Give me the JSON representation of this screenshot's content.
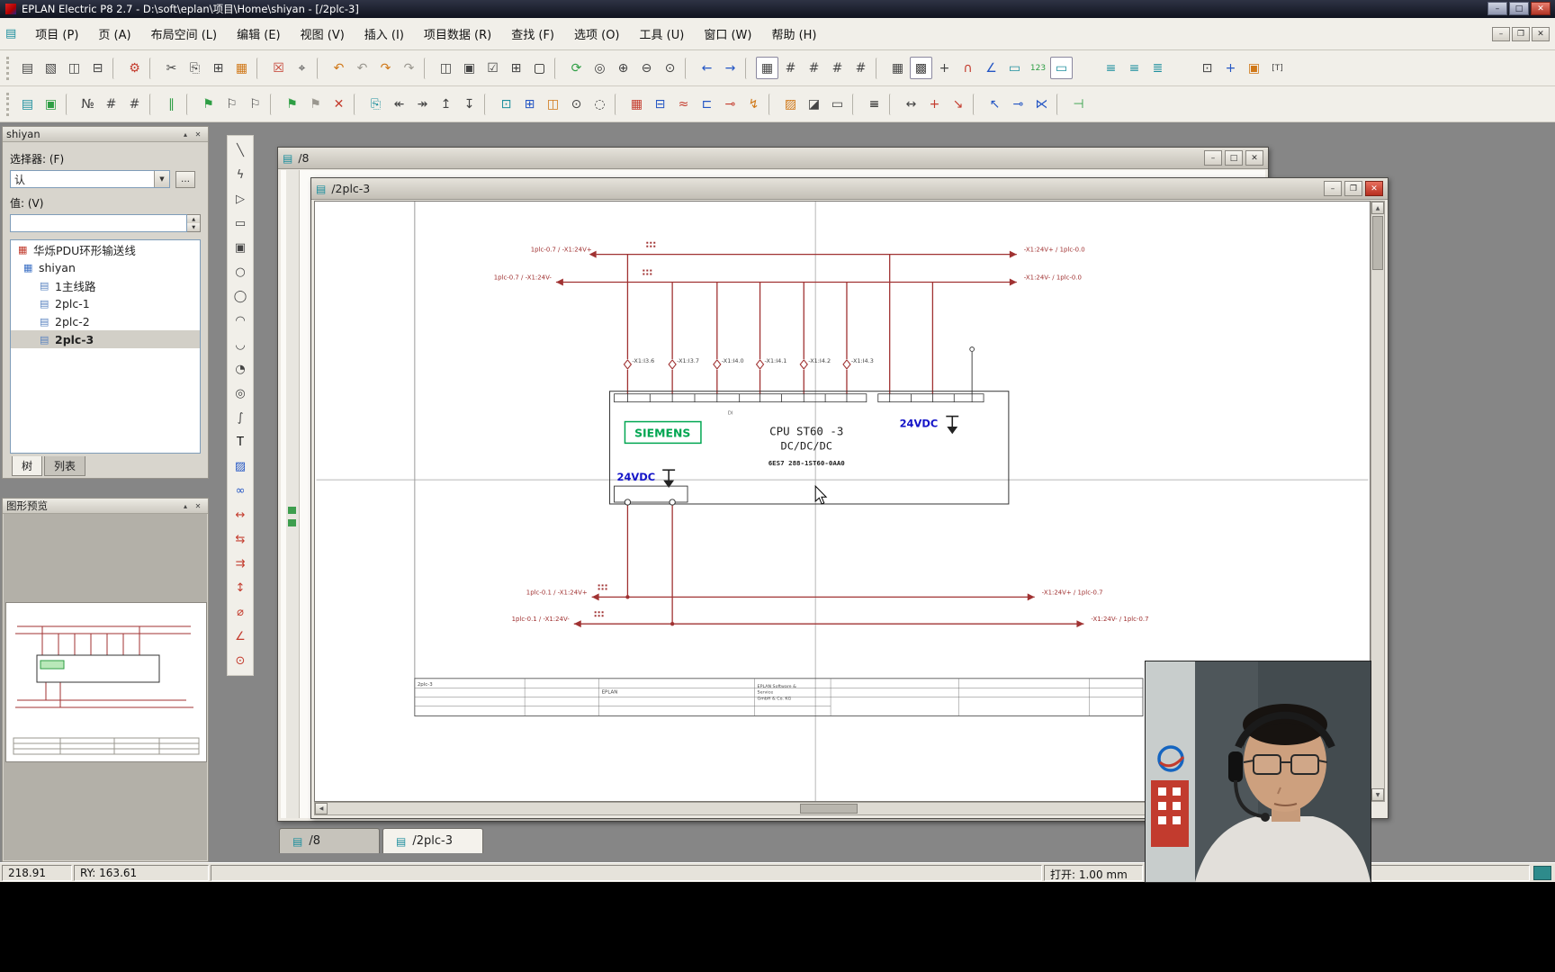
{
  "titlebar": {
    "title": "EPLAN Electric P8 2.7 - D:\\soft\\eplan\\项目\\Home\\shiyan - [/2plc-3]",
    "controls": {
      "min": "–",
      "max": "□",
      "close": "✕"
    }
  },
  "menu": {
    "items": [
      {
        "n": "menu-project",
        "label": "项目 (P)"
      },
      {
        "n": "menu-page",
        "label": "页 (A)"
      },
      {
        "n": "menu-layout-space",
        "label": "布局空间 (L)"
      },
      {
        "n": "menu-edit",
        "label": "编辑 (E)"
      },
      {
        "n": "menu-view",
        "label": "视图 (V)"
      },
      {
        "n": "menu-insert",
        "label": "插入 (I)"
      },
      {
        "n": "menu-project-data",
        "label": "项目数据 (R)"
      },
      {
        "n": "menu-find",
        "label": "查找 (F)"
      },
      {
        "n": "menu-options",
        "label": "选项 (O)"
      },
      {
        "n": "menu-tools",
        "label": "工具 (U)"
      },
      {
        "n": "menu-window",
        "label": "窗口 (W)"
      },
      {
        "n": "menu-help",
        "label": "帮助 (H)"
      }
    ],
    "child_controls": {
      "min": "–",
      "restore": "❐",
      "close": "✕"
    }
  },
  "glyphs": {
    "page_icon": "▤",
    "scroll_left": "◀",
    "scroll_right": "▶",
    "scroll_up": "▲",
    "scroll_down": "▼",
    "dots": "…",
    "combo_arrow": "▼",
    "spin_up": "▲",
    "spin_down": "▼",
    "collapse": "▴",
    "close": "✕"
  },
  "toolbar_main": {
    "items": [
      {
        "n": "new-icon",
        "g": "▤",
        "it": "true"
      },
      {
        "n": "open-icon",
        "g": "▧",
        "it": "true"
      },
      {
        "n": "print-preview-icon",
        "g": "◫",
        "it": "true"
      },
      {
        "n": "print-icon",
        "g": "⊟",
        "it": "true"
      },
      {
        "n": "separator",
        "g": "",
        "it": "false"
      },
      {
        "n": "settings-wrench-icon",
        "g": "⚙",
        "c": "red",
        "it": "true"
      },
      {
        "n": "separator",
        "g": "",
        "it": "false"
      },
      {
        "n": "cut-icon",
        "g": "✂",
        "it": "true"
      },
      {
        "n": "copy-icon",
        "g": "⎘",
        "it": "true"
      },
      {
        "n": "paste-icon",
        "g": "⊞",
        "it": "true"
      },
      {
        "n": "format-brush-icon",
        "g": "▦",
        "c": "orange",
        "it": "true"
      },
      {
        "n": "separator",
        "g": "",
        "it": "false"
      },
      {
        "n": "delete-icon",
        "g": "☒",
        "c": "red",
        "it": "true"
      },
      {
        "n": "select-icon",
        "g": "⌖",
        "it": "true"
      },
      {
        "n": "separator",
        "g": "",
        "it": "false"
      },
      {
        "n": "undo-icon",
        "g": "↶",
        "c": "orange",
        "it": "true"
      },
      {
        "n": "undo-list-icon",
        "g": "↶",
        "c": "gray",
        "it": "true"
      },
      {
        "n": "redo-icon",
        "g": "↷",
        "c": "orange",
        "it": "true"
      },
      {
        "n": "redo-list-icon",
        "g": "↷",
        "c": "gray",
        "it": "true"
      },
      {
        "n": "separator",
        "g": "",
        "it": "false"
      },
      {
        "n": "window-split-icon",
        "g": "◫",
        "it": "true"
      },
      {
        "n": "window-cascade-icon",
        "g": "▣",
        "it": "true"
      },
      {
        "n": "window-check-icon",
        "g": "☑",
        "it": "true"
      },
      {
        "n": "window-grid-icon",
        "g": "⊞",
        "it": "true"
      },
      {
        "n": "workspace-icon",
        "g": "▢",
        "c": "dark",
        "it": "true"
      },
      {
        "n": "separator",
        "g": "",
        "it": "false"
      },
      {
        "n": "refresh-icon",
        "g": "⟳",
        "c": "green",
        "it": "true"
      },
      {
        "n": "zoom-window-icon",
        "g": "◎",
        "it": "true"
      },
      {
        "n": "zoom-in-icon",
        "g": "⊕",
        "it": "true"
      },
      {
        "n": "zoom-out-icon",
        "g": "⊖",
        "it": "true"
      },
      {
        "n": "zoom-100-icon",
        "g": "⊙",
        "it": "true"
      },
      {
        "n": "separator",
        "g": "",
        "it": "false"
      },
      {
        "n": "back-icon",
        "g": "←",
        "c": "blue",
        "it": "true"
      },
      {
        "n": "forward-icon",
        "g": "→",
        "c": "blue",
        "it": "true"
      },
      {
        "n": "separator",
        "g": "",
        "it": "false"
      },
      {
        "n": "grid-a-icon",
        "g": "▦",
        "st": "on",
        "it": "true"
      },
      {
        "n": "grid-b-icon",
        "g": "#",
        "it": "true"
      },
      {
        "n": "grid-c-icon",
        "g": "#",
        "it": "true"
      },
      {
        "n": "grid-d-icon",
        "g": "#",
        "it": "true"
      },
      {
        "n": "grid-e-icon",
        "g": "#",
        "it": "true"
      },
      {
        "n": "separator",
        "g": "",
        "it": "false"
      },
      {
        "n": "grid-display-icon",
        "g": "▦",
        "it": "true"
      },
      {
        "n": "snap-grid-icon",
        "g": "▩",
        "st": "on",
        "it": "true"
      },
      {
        "n": "grid-size-icon",
        "g": "+",
        "it": "true"
      },
      {
        "n": "magnet-icon",
        "g": "∩",
        "c": "red",
        "it": "true"
      },
      {
        "n": "angle-snap-icon",
        "g": "∠",
        "c": "blue",
        "it": "true"
      },
      {
        "n": "ruler-icon",
        "g": "▭",
        "c": "teal",
        "it": "true"
      },
      {
        "n": "value-123-icon",
        "g": "123",
        "c": "green",
        "it": "true"
      },
      {
        "n": "panel-toggle-icon",
        "g": "▭",
        "st": "on",
        "c": "teal",
        "it": "true"
      },
      {
        "n": "spacer",
        "g": "",
        "it": "false"
      },
      {
        "n": "list-view-1-icon",
        "g": "≡",
        "c": "teal",
        "it": "true"
      },
      {
        "n": "list-view-2-icon",
        "g": "≡",
        "c": "teal",
        "it": "true"
      },
      {
        "n": "list-view-3-icon",
        "g": "≣",
        "c": "teal",
        "it": "true"
      },
      {
        "n": "spacer",
        "g": "",
        "it": "false"
      },
      {
        "n": "new-window-icon",
        "g": "⊡",
        "it": "true"
      },
      {
        "n": "position-icon",
        "g": "+",
        "c": "blue",
        "it": "true"
      },
      {
        "n": "cart-icon",
        "g": "▣",
        "c": "orange",
        "it": "true"
      },
      {
        "n": "text-mode-icon",
        "g": "[T]",
        "it": "true"
      }
    ]
  },
  "toolbar_second": {
    "items": [
      {
        "n": "page-nav-icon",
        "g": "▤",
        "c": "teal",
        "it": "true"
      },
      {
        "n": "plugin-icon",
        "g": "▣",
        "c": "green",
        "it": "true"
      },
      {
        "n": "separator",
        "g": "",
        "it": "false"
      },
      {
        "n": "numbering-icon",
        "g": "№",
        "it": "true"
      },
      {
        "n": "numbering-2-icon",
        "g": "#",
        "it": "true"
      },
      {
        "n": "numbering-3-icon",
        "g": "#",
        "it": "true"
      },
      {
        "n": "separator",
        "g": "",
        "it": "false"
      },
      {
        "n": "align-icon",
        "g": "∥",
        "c": "green",
        "it": "true"
      },
      {
        "n": "separator",
        "g": "",
        "it": "false"
      },
      {
        "n": "check-flag-icon",
        "g": "⚑",
        "c": "green",
        "it": "true"
      },
      {
        "n": "flag-2-icon",
        "g": "⚐",
        "it": "true"
      },
      {
        "n": "flag-3-icon",
        "g": "⚐",
        "it": "true"
      },
      {
        "n": "separator",
        "g": "",
        "it": "false"
      },
      {
        "n": "flag-edit-icon",
        "g": "⚑",
        "c": "green",
        "it": "true"
      },
      {
        "n": "flag-next-icon",
        "g": "⚑",
        "c": "gray",
        "it": "true"
      },
      {
        "n": "cancel-icon",
        "g": "✕",
        "c": "red",
        "it": "true"
      },
      {
        "n": "separator",
        "g": "",
        "it": "false"
      },
      {
        "n": "page-copy-icon",
        "g": "⎘",
        "c": "teal",
        "it": "true"
      },
      {
        "n": "page-prev-icon",
        "g": "↞",
        "it": "true"
      },
      {
        "n": "page-next-icon",
        "g": "↠",
        "it": "true"
      },
      {
        "n": "page-up-icon",
        "g": "↥",
        "it": "true"
      },
      {
        "n": "page-down-icon",
        "g": "↧",
        "it": "true"
      },
      {
        "n": "separator",
        "g": "",
        "it": "false"
      },
      {
        "n": "symbol-insert-icon",
        "g": "⊡",
        "c": "teal",
        "it": "true"
      },
      {
        "n": "macro-icon",
        "g": "⊞",
        "c": "blue",
        "it": "true"
      },
      {
        "n": "window-macro-icon",
        "g": "◫",
        "c": "orange",
        "it": "true"
      },
      {
        "n": "circle-symbol-icon",
        "g": "⊙",
        "it": "true"
      },
      {
        "n": "dashed-circle-icon",
        "g": "◌",
        "it": "true"
      },
      {
        "n": "separator",
        "g": "",
        "it": "false"
      },
      {
        "n": "terminal-strip-icon",
        "g": "▦",
        "c": "red",
        "it": "true"
      },
      {
        "n": "device-icon",
        "g": "⊟",
        "c": "blue",
        "it": "true"
      },
      {
        "n": "cable-icon",
        "g": "≈",
        "c": "red",
        "it": "true"
      },
      {
        "n": "box-symbol-icon",
        "g": "⊏",
        "c": "blue",
        "it": "true"
      },
      {
        "n": "connection-icon",
        "g": "⊸",
        "c": "red",
        "it": "true"
      },
      {
        "n": "potential-icon",
        "g": "↯",
        "c": "orange",
        "it": "true"
      },
      {
        "n": "separator",
        "g": "",
        "it": "false"
      },
      {
        "n": "hatch-layer-icon",
        "g": "▨",
        "c": "orange",
        "it": "true"
      },
      {
        "n": "corner-hatch-icon",
        "g": "◪",
        "it": "true"
      },
      {
        "n": "dashed-rect-icon",
        "g": "▭",
        "it": "true"
      },
      {
        "n": "separator",
        "g": "",
        "it": "false"
      },
      {
        "n": "align-stack-icon",
        "g": "≡",
        "c": "dark",
        "it": "true"
      },
      {
        "n": "separator",
        "g": "",
        "it": "false"
      },
      {
        "n": "dimension-h-icon",
        "g": "↔",
        "it": "true"
      },
      {
        "n": "move-cross-icon",
        "g": "+",
        "c": "red",
        "it": "true"
      },
      {
        "n": "arrow-se-icon",
        "g": "↘",
        "c": "red",
        "it": "true"
      },
      {
        "n": "separator",
        "g": "",
        "it": "false"
      },
      {
        "n": "cursor-nw-icon",
        "g": "↖",
        "c": "blue",
        "it": "true"
      },
      {
        "n": "probe-icon",
        "g": "⊸",
        "c": "blue",
        "it": "true"
      },
      {
        "n": "snap-k-icon",
        "g": "⋉",
        "c": "blue",
        "it": "true"
      },
      {
        "n": "separator",
        "g": "",
        "it": "false"
      },
      {
        "n": "end-tool-icon",
        "g": "⊣",
        "c": "green",
        "it": "true"
      }
    ]
  },
  "draw_toolbar": {
    "items": [
      {
        "n": "line-icon",
        "g": "╲",
        "it": "true"
      },
      {
        "n": "polyline-icon",
        "g": "ϟ",
        "it": "true"
      },
      {
        "n": "polygon-icon",
        "g": "▷",
        "it": "true"
      },
      {
        "n": "rectangle-icon",
        "g": "▭",
        "it": "true"
      },
      {
        "n": "rectangle-center-icon",
        "g": "▣",
        "it": "true"
      },
      {
        "n": "circle-icon",
        "g": "○",
        "it": "true"
      },
      {
        "n": "ellipse-icon",
        "g": "◯",
        "it": "true"
      },
      {
        "n": "arc-icon",
        "g": "◠",
        "it": "true"
      },
      {
        "n": "arc-center-icon",
        "g": "◡",
        "it": "true"
      },
      {
        "n": "sector-icon",
        "g": "◔",
        "it": "true"
      },
      {
        "n": "circle-fill-icon",
        "g": "◎",
        "it": "true"
      },
      {
        "n": "spline-icon",
        "g": "∫",
        "it": "true"
      },
      {
        "n": "text-icon",
        "g": "T",
        "c": "dark",
        "it": "true"
      },
      {
        "n": "image-icon",
        "g": "▨",
        "c": "blue",
        "it": "true"
      },
      {
        "n": "hyperlink-icon",
        "g": "∞",
        "c": "blue",
        "it": "true"
      },
      {
        "n": "dim-linear-icon",
        "g": "↔",
        "c": "red",
        "it": "true"
      },
      {
        "n": "dim-chain-icon",
        "g": "⇆",
        "c": "red",
        "it": "true"
      },
      {
        "n": "dim-baseline-icon",
        "g": "⇉",
        "c": "red",
        "it": "true"
      },
      {
        "n": "dim-vertical-icon",
        "g": "↕",
        "c": "red",
        "it": "true"
      },
      {
        "n": "dim-radius-icon",
        "g": "⌀",
        "c": "red",
        "it": "true"
      },
      {
        "n": "dim-angle-icon",
        "g": "∠",
        "c": "red",
        "it": "true"
      },
      {
        "n": "dim-point-icon",
        "g": "⊙",
        "c": "red",
        "it": "true"
      }
    ]
  },
  "selector_panel": {
    "title": "shiyan",
    "selector_label": "选择器: (F)",
    "combo_value": "认",
    "value_label": "值: (V)",
    "value_input": "",
    "tabs": [
      {
        "n": "tab-tree",
        "label": "树",
        "active": "true"
      },
      {
        "n": "tab-list",
        "label": "列表",
        "active": "false"
      }
    ]
  },
  "project_tree": {
    "items": [
      {
        "n": "tree-item-project",
        "icn": "project-icon",
        "icon": "▦",
        "ic": "red",
        "label": "华烁PDU环形输送线",
        "level": "0",
        "active": "false"
      },
      {
        "n": "tree-item-shiyan",
        "icn": "project-icon",
        "icon": "▦",
        "ic": "blue",
        "label": "shiyan",
        "level": "1",
        "active": "false"
      },
      {
        "n": "tree-item-1zhuxianlu",
        "icn": "page-icon",
        "icon": "▤",
        "ic": "page",
        "label": "1主线路",
        "level": "2",
        "active": "false"
      },
      {
        "n": "tree-item-2plc-1",
        "icn": "page-icon",
        "icon": "▤",
        "ic": "page",
        "label": "2plc-1",
        "level": "2",
        "active": "false"
      },
      {
        "n": "tree-item-2plc-2",
        "icn": "page-icon",
        "icon": "▤",
        "ic": "page",
        "label": "2plc-2",
        "level": "2",
        "active": "false"
      },
      {
        "n": "tree-item-2plc-3",
        "icn": "page-icon",
        "icon": "▤",
        "ic": "page",
        "label": "2plc-3",
        "level": "2",
        "active": "true"
      }
    ]
  },
  "preview_panel": {
    "title": "图形预览"
  },
  "mdi": {
    "back_window": {
      "title": "/8",
      "controls": {
        "min": "–",
        "max": "□",
        "close": "✕"
      }
    },
    "front_window": {
      "title": "/2plc-3",
      "controls": {
        "min": "–",
        "max": "❐",
        "close": "✕"
      }
    },
    "sheet_tabs": [
      {
        "n": "sheet-tab-8",
        "icon": "▤",
        "label": "/8",
        "active": "false"
      },
      {
        "n": "sheet-tab-2plc-3",
        "icon": "▤",
        "label": "/2plc-3",
        "active": "true"
      }
    ]
  },
  "schematic": {
    "buses": {
      "top1_left": "1plc-0.7 / -X1:24V+",
      "top1_right": "-X1:24V+ / 1plc-0.0",
      "top2_left": "1plc-0.7 / -X1:24V-",
      "top2_right": "-X1:24V- / 1plc-0.0",
      "bot1_left": "1plc-0.1 / -X1:24V+",
      "bot1_right": "-X1:24V+ / 1plc-0.7",
      "bot2_left": "1plc-0.1 / -X1:24V-",
      "bot2_right": "-X1:24V- / 1plc-0.7"
    },
    "terminals": [
      "-X1:I3.6",
      "-X1:I3.7",
      "-X1:I4.0",
      "-X1:I4.1",
      "-X1:I4.2",
      "-X1:I4.3"
    ],
    "plc": {
      "brand": "SIEMENS",
      "cpu": "CPU ST60 -3",
      "type": "DC/DC/DC",
      "order_no": "6ES7 288-1ST60-0AA0",
      "di_label": "DI",
      "supply1": "24VDC",
      "supply2": "24VDC"
    },
    "title_block": {
      "page": "2plc-3",
      "company": "EPLAN",
      "vendor1": "EPLAN Software &",
      "vendor2": "Service",
      "vendor3": "GmbH & Co. KG"
    }
  },
  "statusbar": {
    "x": "218.91",
    "y": "RY: 163.61",
    "grid": "打开: 1.00 mm"
  },
  "accent_colors": {
    "wire_red": "#a03232",
    "siemens_green": "#00a651",
    "supply_blue": "#1414c8"
  }
}
